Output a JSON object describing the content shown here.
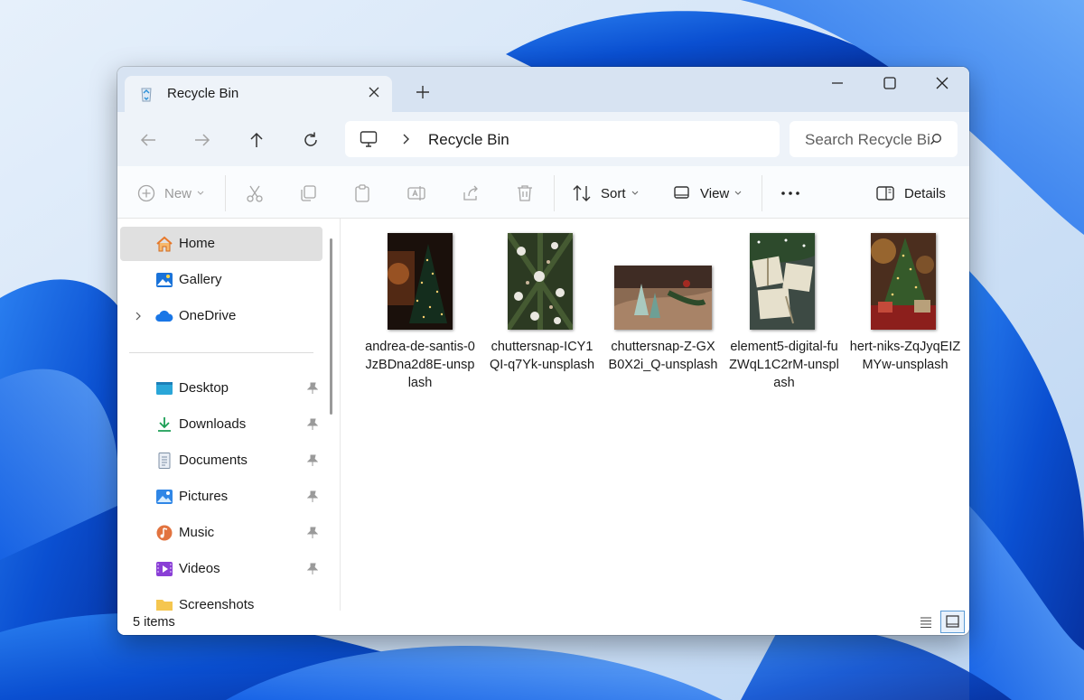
{
  "tab": {
    "title": "Recycle Bin",
    "icon": "recycle-bin-icon"
  },
  "address_bar": {
    "location": "Recycle Bin"
  },
  "search": {
    "placeholder": "Search Recycle Bin"
  },
  "toolbar": {
    "new_label": "New",
    "sort_label": "Sort",
    "view_label": "View",
    "details_label": "Details"
  },
  "sidebar": {
    "items": [
      {
        "label": "Home",
        "icon": "home-icon",
        "selected": true
      },
      {
        "label": "Gallery",
        "icon": "gallery-icon"
      },
      {
        "label": "OneDrive",
        "icon": "onedrive-icon",
        "expandable": true
      },
      {
        "label": "Desktop",
        "icon": "desktop-icon",
        "pinned": true
      },
      {
        "label": "Downloads",
        "icon": "downloads-icon",
        "pinned": true
      },
      {
        "label": "Documents",
        "icon": "documents-icon",
        "pinned": true
      },
      {
        "label": "Pictures",
        "icon": "pictures-icon",
        "pinned": true
      },
      {
        "label": "Music",
        "icon": "music-icon",
        "pinned": true
      },
      {
        "label": "Videos",
        "icon": "videos-icon",
        "pinned": true
      },
      {
        "label": "Screenshots",
        "icon": "folder-icon"
      }
    ]
  },
  "files": [
    {
      "name": "andrea-de-santis-0JzBDna2d8E-unsplash"
    },
    {
      "name": "chuttersnap-ICY1QI-q7Yk-unsplash"
    },
    {
      "name": "chuttersnap-Z-GXB0X2i_Q-unsplash"
    },
    {
      "name": "element5-digital-fuZWqL1C2rM-unsplash"
    },
    {
      "name": "hert-niks-ZqJyqEIZMYw-unsplash"
    }
  ],
  "status": {
    "item_count": "5 items"
  },
  "colors": {
    "accent": "#0067c0",
    "titlebar": "#d7e3f2",
    "navbar": "#eef3f9"
  }
}
